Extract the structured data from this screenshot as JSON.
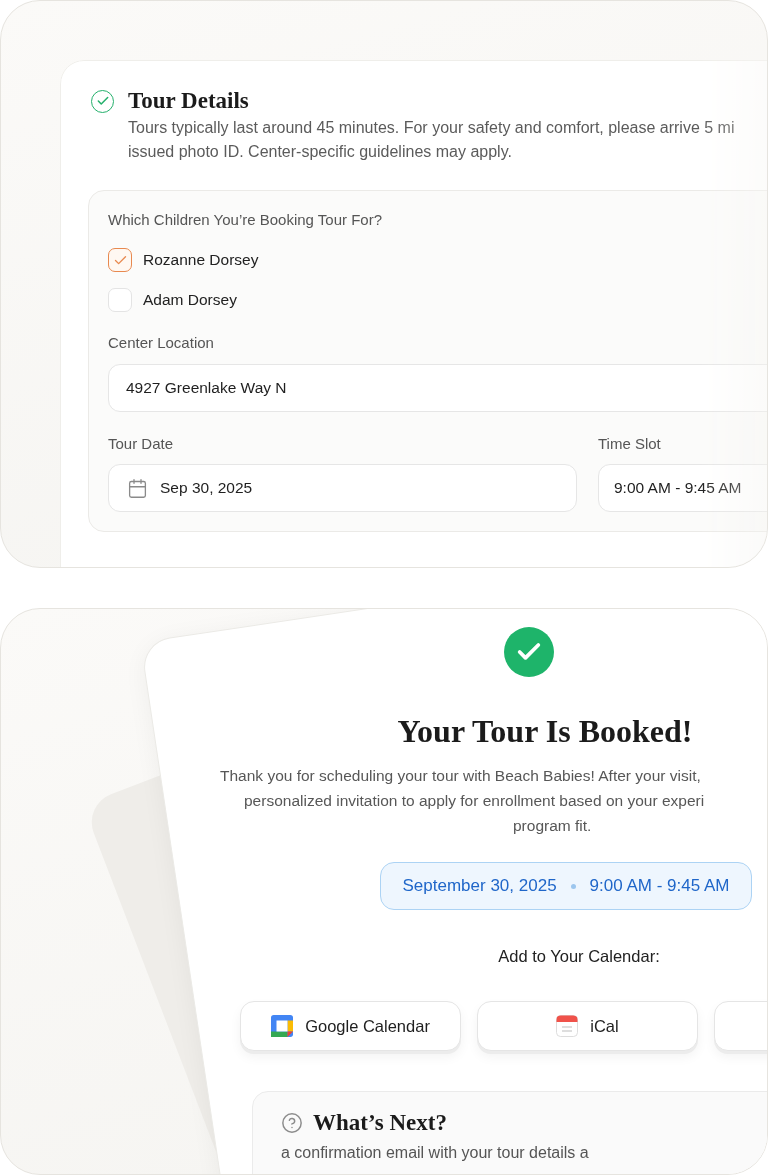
{
  "tour_details": {
    "completed": true,
    "title": "Tour Details",
    "description_lines": [
      "Tours typically last around 45 minutes. For your safety and comfort, please arrive 5 mi",
      "issued photo ID. Center-specific guidelines may apply."
    ],
    "children_question": "Which Children You’re Booking Tour For?",
    "children": [
      {
        "name": "Rozanne Dorsey",
        "checked": true
      },
      {
        "name": "Adam Dorsey",
        "checked": false
      }
    ],
    "location": {
      "label": "Center Location",
      "value": "4927 Greenlake Way N"
    },
    "tour_date": {
      "label": "Tour Date",
      "value": "Sep 30, 2025"
    },
    "time_slot": {
      "label": "Time Slot",
      "value": "9:00 AM - 9:45 AM"
    }
  },
  "confirmation": {
    "title": "Your Tour Is Booked!",
    "description_lines": [
      "Thank you for scheduling your tour with Beach Babies! After your visit,",
      "personalized invitation to apply for enrollment based on your experi",
      "program fit."
    ],
    "booking": {
      "date": "September 30, 2025",
      "time": "9:00 AM - 9:45 AM"
    },
    "calendar_prompt": "Add to Your Calendar:",
    "calendar_buttons": [
      {
        "kind": "google",
        "label": "Google Calendar"
      },
      {
        "kind": "ical",
        "label": "iCal"
      },
      {
        "kind": "other"
      }
    ],
    "whats_next": {
      "title": "What’s Next?",
      "body": "a confirmation email with your tour details a"
    }
  }
}
